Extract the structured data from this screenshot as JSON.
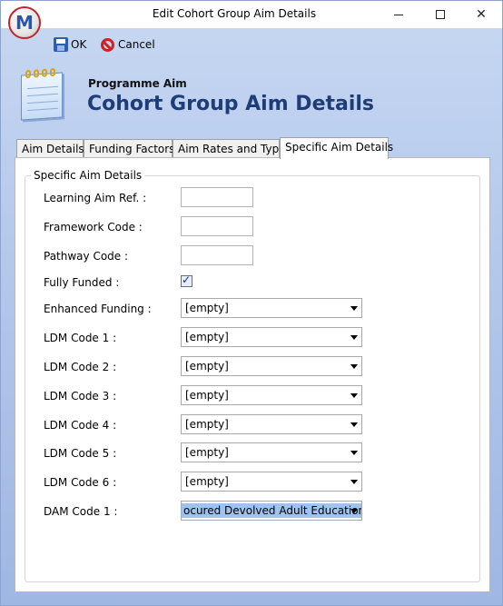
{
  "window": {
    "title": "Edit Cohort Group Aim Details",
    "logo_text": "M"
  },
  "toolbar": {
    "ok_label": "OK",
    "cancel_label": "Cancel"
  },
  "header": {
    "subtitle": "Programme Aim",
    "title": "Cohort Group Aim Details"
  },
  "tabs": [
    {
      "label": "Aim Details"
    },
    {
      "label": "Funding Factors"
    },
    {
      "label": "Aim Rates and Type"
    },
    {
      "label": "Specific Aim Details"
    }
  ],
  "form": {
    "group_title": "Specific Aim Details",
    "learning_aim_ref": {
      "label": "Learning Aim Ref. :",
      "value": ""
    },
    "framework_code": {
      "label": "Framework Code :",
      "value": ""
    },
    "pathway_code": {
      "label": "Pathway Code :",
      "value": ""
    },
    "fully_funded": {
      "label": "Fully Funded :",
      "checked": true
    },
    "enhanced_funding": {
      "label": "Enhanced Funding :",
      "value": "[empty]"
    },
    "ldm1": {
      "label": "LDM Code 1 :",
      "value": "[empty]"
    },
    "ldm2": {
      "label": "LDM Code 2 :",
      "value": "[empty]"
    },
    "ldm3": {
      "label": "LDM Code 3 :",
      "value": "[empty]"
    },
    "ldm4": {
      "label": "LDM Code 4 :",
      "value": "[empty]"
    },
    "ldm5": {
      "label": "LDM Code 5 :",
      "value": "[empty]"
    },
    "ldm6": {
      "label": "LDM Code 6 :",
      "value": "[empty]"
    },
    "dam1": {
      "label": "DAM Code 1 :",
      "value": "ocured Devolved Adult Education"
    }
  }
}
